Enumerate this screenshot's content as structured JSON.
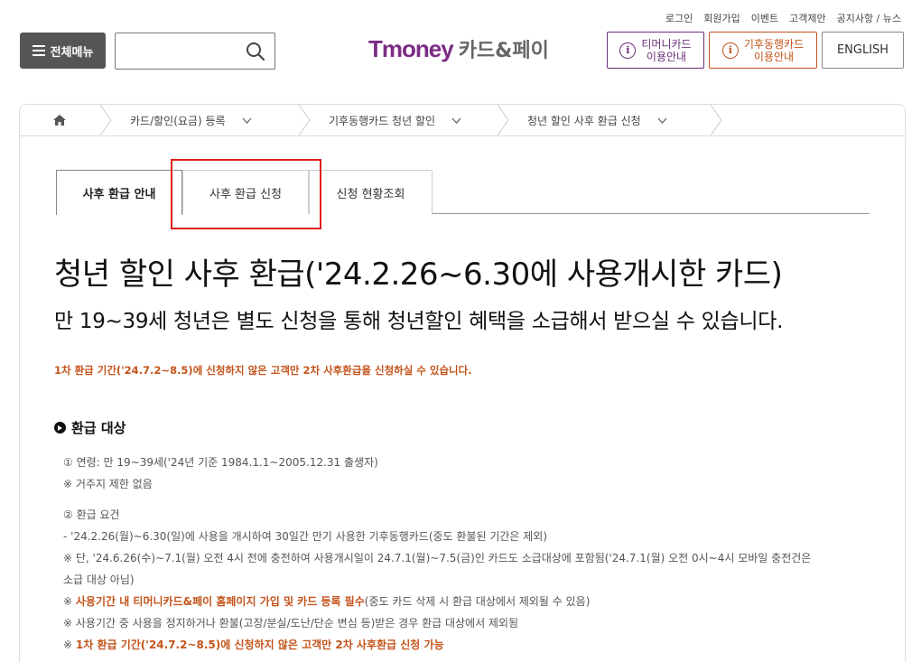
{
  "util_links": [
    "로그인",
    "회원가입",
    "이벤트",
    "고객제안",
    "공지사항 / 뉴스"
  ],
  "header": {
    "menu_label": "전체메뉴",
    "search_placeholder": "",
    "logo_text": "Tmoney",
    "logo_sub": "카드&페이",
    "btn_tmoney": [
      "티머니카드",
      "이용안내"
    ],
    "btn_climate": [
      "기후동행카드",
      "이용안내"
    ],
    "btn_english": "ENGLISH"
  },
  "breadcrumb": [
    "카드/할인(요금) 등록",
    "기후동행카드 청년 할인",
    "청년 할인 사후 환급 신청"
  ],
  "tabs": [
    "사후 환급 안내",
    "사후 환급 신청",
    "신청 현황조회"
  ],
  "main": {
    "title": "청년 할인 사후 환급('24.2.26~6.30에 사용개시한 카드)",
    "subtitle": "만 19~39세 청년은 별도 신청을 통해 청년할인 혜택을 소급해서 받으실 수 있습니다.",
    "notice": "1차 환급 기간('24.7.2~8.5)에 신청하지 않은 고객만 2차 사후환급을 신청하실 수 있습니다.",
    "section_title": "환급 대상",
    "lines": {
      "l1": "① 연령: 만 19~39세('24년 기준 1984.1.1~2005.12.31 출생자)",
      "l2": "※ 거주지 제한 없음",
      "l3": "② 환급 요건",
      "l4": "- '24.2.26(월)~6.30(일)에 사용을 개시하여 30일간 만기 사용한 기후동행카드(중도 환불된 기간은 제외)",
      "l5": "※ 단, '24.6.26(수)~7.1(월) 오전 4시 전에 충전하여 사용개시일이 24.7.1(월)~7.5(금)인 카드도 소급대상에 포함됨('24.7.1(월) 오전 0시~4시 모바일 충전건은",
      "l6": "소급 대상 아님)",
      "l7_prefix": "※ ",
      "l7_strong": "사용기간 내 티머니카드&페이 홈페이지 가입 및 카드 등록 필수",
      "l7_rest": "(중도 카드 삭제 시 환급 대상에서 제외될 수 있음)",
      "l8": "※ 사용기간 중 사용을 정지하거나 환불(고장/분실/도난/단순 변심 등)받은 경우 환급 대상에서 제외됨",
      "l9_prefix": "※ ",
      "l9_strong": "1차 환급 기간('24.7.2~8.5)에 신청하지 않은 고객만 2차 사후환급 신청 가능"
    }
  },
  "colors": {
    "accent_purple": "#7b2c85",
    "accent_orange": "#c4541b",
    "highlight_red": "#e01e1e"
  }
}
